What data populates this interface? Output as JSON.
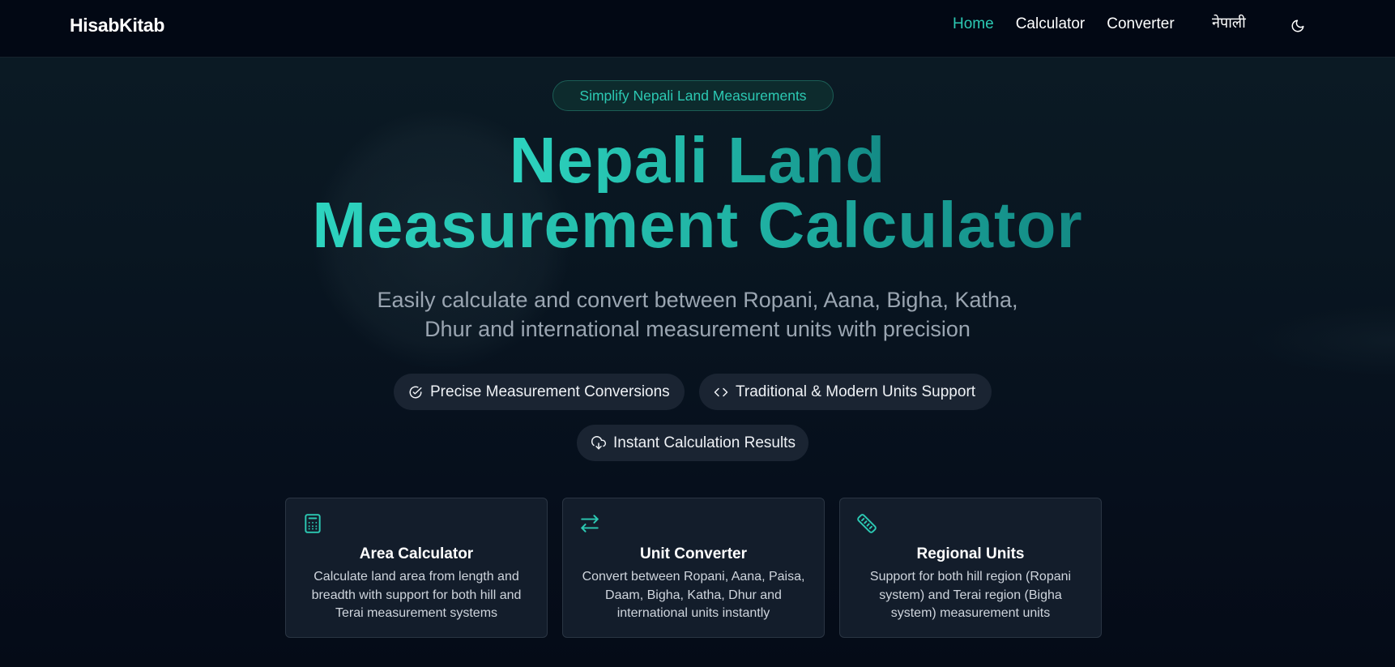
{
  "nav": {
    "brand": "HisabKitab",
    "links": [
      {
        "label": "Home",
        "active": true
      },
      {
        "label": "Calculator",
        "active": false
      },
      {
        "label": "Converter",
        "active": false
      }
    ],
    "language": "नेपाली",
    "theme_icon": "moon-icon"
  },
  "hero": {
    "badge": "Simplify Nepali Land Measurements",
    "title_line1": "Nepali Land",
    "title_line2": "Measurement Calculator",
    "subtitle_line1": "Easily calculate and convert between Ropani, Aana, Bigha, Katha,",
    "subtitle_line2": "Dhur and international measurement units with precision"
  },
  "features": [
    {
      "label": "Precise Measurement Conversions",
      "icon": "check-circle-icon"
    },
    {
      "label": "Traditional & Modern Units Support",
      "icon": "code-icon"
    },
    {
      "label": "Instant Calculation Results",
      "icon": "cloud-download-icon"
    }
  ],
  "cards": [
    {
      "icon": "calculator-icon",
      "title": "Area Calculator",
      "text": "Calculate land area from length and breadth with support for both hill and Terai measurement systems"
    },
    {
      "icon": "arrows-exchange-icon",
      "title": "Unit Converter",
      "text": "Convert between Ropani, Aana, Paisa, Daam, Bigha, Katha, Dhur and international units instantly"
    },
    {
      "icon": "ruler-icon",
      "title": "Regional Units",
      "text": "Support for both hill region (Ropani system) and Terai region (Bigha system) measurement units"
    }
  ],
  "colors": {
    "accent": "#2cc9b3",
    "background": "#060d1a",
    "navbar": "#020814",
    "card": "#131d2b"
  }
}
